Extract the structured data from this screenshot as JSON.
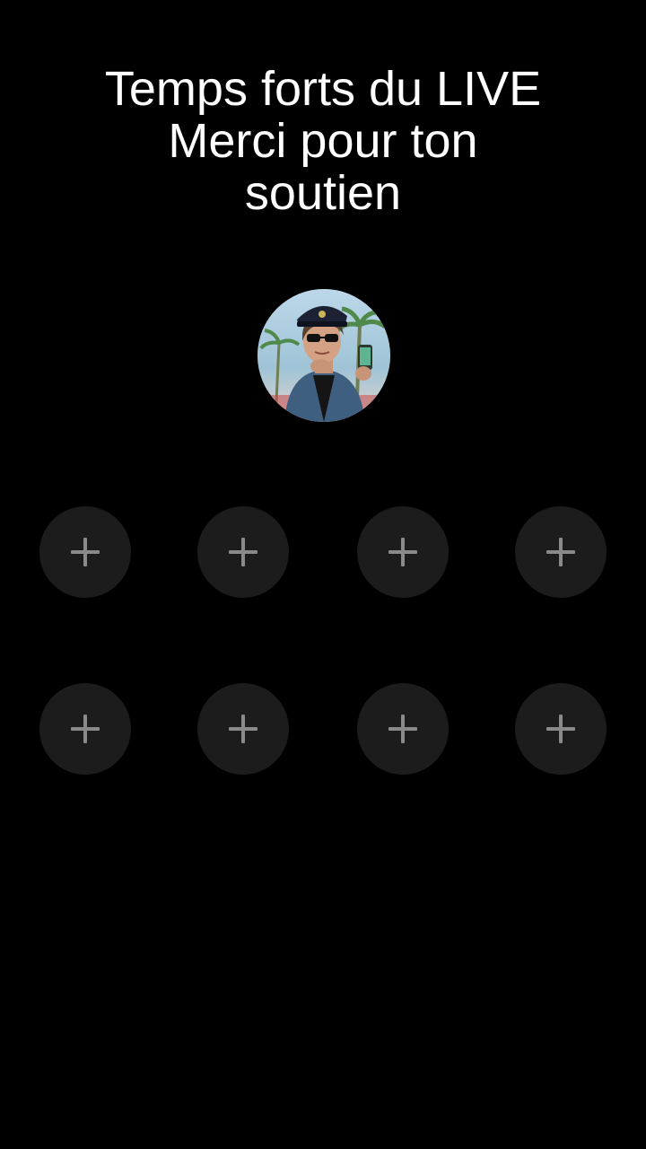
{
  "header": {
    "title_lines": [
      "Temps forts du LIVE",
      "Merci pour ton",
      "soutien"
    ]
  },
  "host": {
    "avatar_alt": "host-avatar"
  },
  "slots": {
    "add_icon": "plus-icon",
    "count": 8
  },
  "colors": {
    "background": "#000000",
    "text": "#ffffff",
    "slot_fill": "#1c1c1c",
    "plus": "#8a8a8a"
  }
}
